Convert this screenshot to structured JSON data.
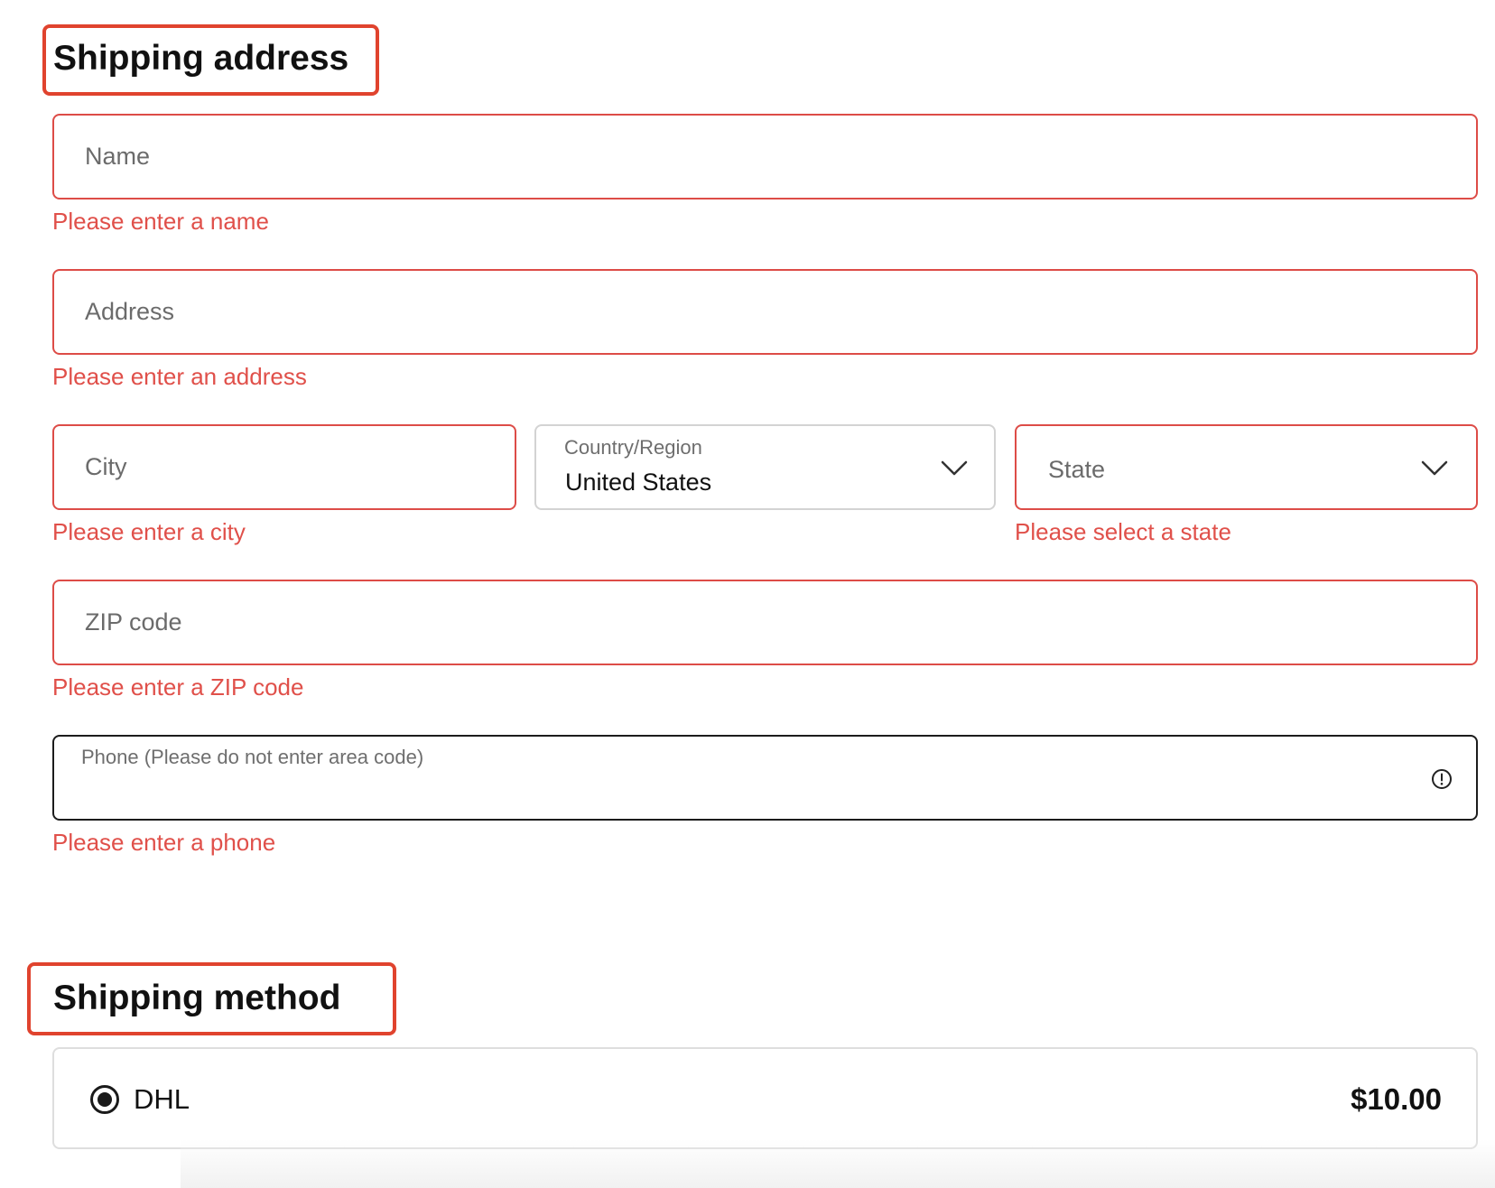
{
  "shipping_address": {
    "title": "Shipping address",
    "name": {
      "placeholder": "Name",
      "value": "",
      "error": "Please enter a name"
    },
    "address": {
      "placeholder": "Address",
      "value": "",
      "error": "Please enter an address"
    },
    "city": {
      "placeholder": "City",
      "value": "",
      "error": "Please enter a city"
    },
    "country": {
      "label": "Country/Region",
      "value": "United States",
      "icon": "chevron-down-icon"
    },
    "state": {
      "placeholder": "State",
      "error": "Please select a state",
      "icon": "chevron-down-icon"
    },
    "zip": {
      "placeholder": "ZIP code",
      "value": "",
      "error": "Please enter a ZIP code"
    },
    "phone": {
      "label": "Phone (Please do not enter area code)",
      "value": "",
      "error": "Please enter a phone",
      "icon": "info-circle-icon"
    }
  },
  "shipping_method": {
    "title": "Shipping method",
    "options": [
      {
        "name": "DHL",
        "price": "$10.00",
        "selected": true
      }
    ]
  },
  "colors": {
    "error": "#e0504a",
    "heading_box": "#e0432e",
    "field_border_error": "#dd4c47",
    "field_border_neutral": "#d3d3d3",
    "field_border_focus": "#1c1c1c"
  }
}
